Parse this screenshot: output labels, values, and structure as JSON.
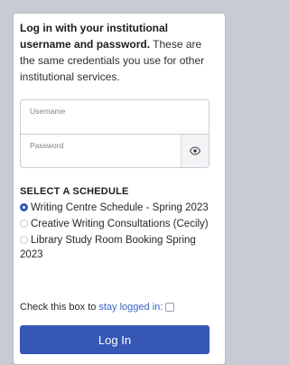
{
  "intro": {
    "bold": "Log in with your institutional username and password.",
    "rest": " These are the same credentials you use for other institutional services."
  },
  "fields": {
    "username_label": "Username",
    "username_value": "",
    "password_label": "Password",
    "password_value": ""
  },
  "icons": {
    "show_password": "eye-icon"
  },
  "schedule": {
    "title": "SELECT A SCHEDULE",
    "options": [
      {
        "label": "Writing Centre Schedule - Spring 2023",
        "selected": true
      },
      {
        "label": "Creative Writing Consultations (Cecily)",
        "selected": false
      },
      {
        "label": "Library Study Room Booking Spring 2023",
        "selected": false
      }
    ]
  },
  "keep": {
    "prefix": "Check this box to",
    "link": "stay logged in:",
    "checked": false
  },
  "login_button": "Log In",
  "colors": {
    "accent": "#3657b4",
    "link": "#3a63c4"
  }
}
